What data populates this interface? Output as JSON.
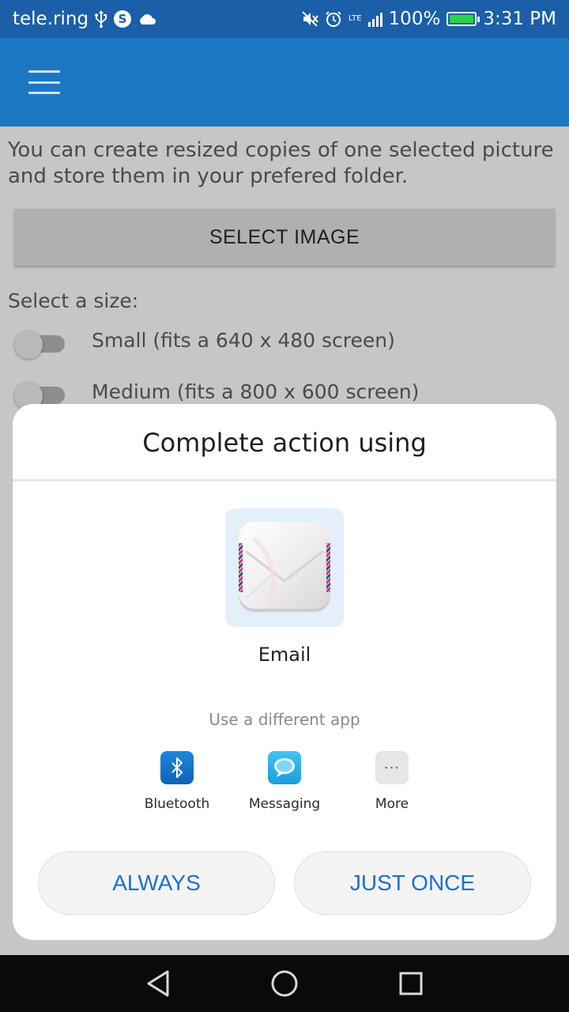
{
  "status_bar": {
    "carrier": "tele.ring",
    "skype_glyph": "S",
    "network_type": "LTE",
    "battery_percent": "100%",
    "battery_level": 1.0,
    "time": "3:31 PM",
    "icons": [
      "usb-icon",
      "skype-icon",
      "cloud-icon",
      "mute-icon",
      "alarm-icon",
      "signal-icon",
      "battery-icon"
    ]
  },
  "app_bar": {
    "menu_icon": "hamburger-menu-icon"
  },
  "main": {
    "intro_text": "You can create resized copies of one selected picture and store them in your prefered folder.",
    "select_button_label": "SELECT IMAGE",
    "size_label": "Select a size:",
    "sizes": [
      {
        "label": "Small (fits a 640 x 480 screen)",
        "enabled": false
      },
      {
        "label": "Medium (fits a 800 x 600 screen)",
        "enabled": false
      }
    ]
  },
  "dialog": {
    "title": "Complete action using",
    "suggested_app": {
      "label": "Email",
      "icon": "email-app-icon"
    },
    "different_app_label": "Use a different app",
    "share_apps": [
      {
        "label": "Bluetooth",
        "icon": "bluetooth-icon"
      },
      {
        "label": "Messaging",
        "icon": "messaging-icon"
      },
      {
        "label": "More",
        "icon": "more-icon",
        "glyph": "···"
      }
    ],
    "always_label": "ALWAYS",
    "just_once_label": "JUST ONCE"
  },
  "nav_bar": {
    "icons": [
      "back-icon",
      "home-icon",
      "recents-icon"
    ]
  },
  "colors": {
    "status_bar": "#1a5fa8",
    "app_bar": "#1c77c3",
    "accent": "#1c6fd2",
    "battery": "#2bd34a"
  }
}
